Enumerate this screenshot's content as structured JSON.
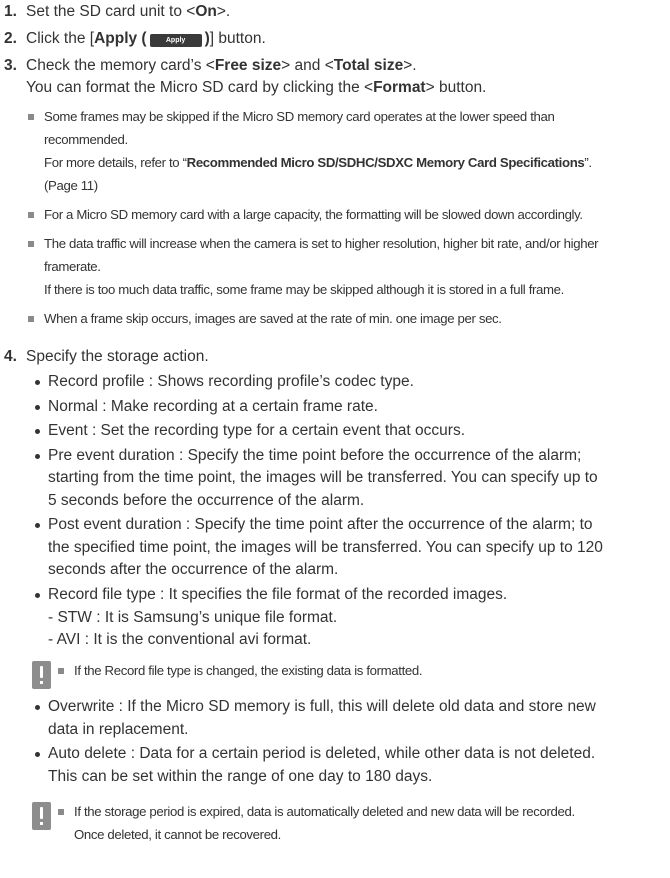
{
  "steps": {
    "s1": {
      "num": "1.",
      "pre": "Set the SD card unit to <",
      "bold": "On",
      "post": ">."
    },
    "s2": {
      "num": "2.",
      "pre": "Click the [",
      "bold": "Apply (",
      "button_label": "Apply",
      "bold_close": ")",
      "post": "] button."
    },
    "s3": {
      "num": "3.",
      "l1_pre": "Check the memory card’s <",
      "l1_b1": "Free size",
      "l1_mid": "> and <",
      "l1_b2": "Total size",
      "l1_post": ">.",
      "l2_pre": "You can format the Micro SD card by clicking the <",
      "l2_b": "Format",
      "l2_post": "> button."
    },
    "s4": {
      "num": "4.",
      "text": "Specify the storage action."
    }
  },
  "notes": [
    {
      "l1": "Some frames may be skipped if the Micro SD memory card operates at the lower speed than",
      "l2": "recommended.",
      "l3_pre": "For more details, refer to “",
      "l3_b": "Recommended Micro SD/SDHC/SDXC Memory Card Specifications",
      "l3_post": "”.",
      "l4": "(Page 11)"
    },
    {
      "l1": "For a Micro SD memory card with a large capacity, the formatting will be slowed down accordingly."
    },
    {
      "l1": "The data traffic will increase when the camera is set to higher resolution, higher bit rate, and/or higher",
      "l2": "framerate.",
      "l3": "If there is too much data traffic, some frame may be skipped although it is stored in a full frame."
    },
    {
      "l1": "When a frame skip occurs, images are saved at the rate of min. one image per sec."
    }
  ],
  "bullets": [
    {
      "l1": "Record profile : Shows recording profile’s codec type."
    },
    {
      "l1": "Normal : Make recording at a certain frame rate."
    },
    {
      "l1": "Event : Set the recording type for a certain event that occurs."
    },
    {
      "l1": "Pre event duration : Specify the time point before the occurrence of the alarm;",
      "l2": "starting from the time point, the images will be transferred. You can specify up to",
      "l3": "5 seconds before the occurrence of the alarm."
    },
    {
      "l1": "Post event duration : Specify the time point after the occurrence of the alarm; to",
      "l2": "the specified time point, the images will be transferred. You can specify up to 120",
      "l3": "seconds after the occurrence of the alarm."
    },
    {
      "l1": "Record file type : It specifies the file format of the recorded images.",
      "sub1": "- STW : It is Samsung’s unique file format.",
      "sub2": "- AVI : It is the conventional avi format."
    }
  ],
  "caution1": {
    "l1": "If the Record file type is changed, the existing data is formatted."
  },
  "bullets2": [
    {
      "l1": "Overwrite : If the Micro SD memory is full, this will delete old data and store new",
      "l2": "data in replacement."
    },
    {
      "l1": "Auto delete : Data for a certain period is deleted, while other data is not deleted.",
      "l2": "This can be set within the range of one day to 180 days."
    }
  ],
  "caution2": {
    "l1": "If the storage period is expired, data is automatically deleted and new data will be recorded.",
    "l2": "Once deleted, it cannot be recovered."
  }
}
